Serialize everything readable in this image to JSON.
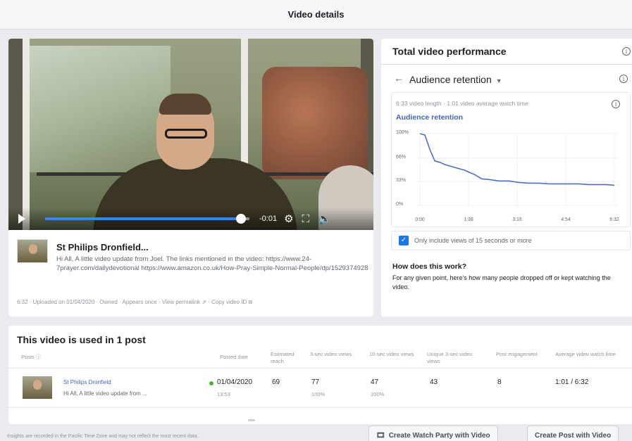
{
  "header": {
    "title": "Video details"
  },
  "player": {
    "progress": 0.96,
    "time_left": "-0:01",
    "icons": [
      "play-icon",
      "gear-icon",
      "fullscreen-icon",
      "volume-icon"
    ]
  },
  "post": {
    "page_name": "St Philips Dronfield...",
    "text": "Hi All, A little video update from Joel. The links mentioned in the video: https://www.24-7prayer.com/dailydevotional https://www.amazon.co.uk/How-Pray-Simple-Normal-People/dp/1529374928",
    "meta": "6:32 · Uploaded on 01/04/2020 · Owned · Appears once · View permalink ⇗ · Copy video ID ⧉"
  },
  "performance": {
    "title": "Total video performance",
    "back_label": "←",
    "dropdown_label": "Audience retention",
    "length_text": "6:33 video length · 1:01 video average watch time",
    "chart_title": "Audience retention",
    "checkbox_label": "Only include views of 15 seconds or more",
    "checkbox_checked": true,
    "how_title": "How does this work?",
    "how_text": "For any given point, here's how many people dropped off or kept watching the video."
  },
  "chart_data": {
    "type": "line",
    "title": "Audience retention",
    "x_ticks": [
      "0:00",
      "1:38",
      "3:16",
      "4:54",
      "6:32"
    ],
    "y_ticks": [
      "100%",
      "66%",
      "33%",
      "0%"
    ],
    "ylim": [
      0,
      100
    ],
    "xlim": [
      0,
      392
    ],
    "series": [
      {
        "name": "",
        "color": "#4a6fd1",
        "x": [
          0,
          10,
          20,
          30,
          40,
          50,
          60,
          75,
          90,
          100,
          110,
          125,
          140,
          160,
          180,
          200,
          220,
          240,
          260,
          280,
          300,
          320,
          340,
          360,
          375,
          392
        ],
        "y": [
          100,
          98,
          78,
          62,
          60,
          57,
          55,
          52,
          49,
          46,
          43,
          37,
          36,
          34,
          34,
          32,
          31,
          31,
          30,
          30,
          30,
          30,
          29,
          29,
          29,
          28
        ]
      }
    ]
  },
  "usage": {
    "title": "This video is used in 1 post",
    "columns": [
      "Posts ⓘ",
      "Posted date",
      "Estimated reach",
      "3-sec video views",
      "10-sec video views",
      "Unique 3-sec video views",
      "Post engagement",
      "Average video watch time"
    ],
    "row": {
      "page": "St Philips Dronfield",
      "text": "Hi All, A little video update from ...",
      "date": "01/04/2020",
      "time": "13:53",
      "reach": "69",
      "views3": "77",
      "views3_sub": "100%",
      "views10": "47",
      "views10_sub": "100%",
      "unique3": "43",
      "engagement": "8",
      "avg_watch": "1:01 / 6:32"
    }
  },
  "footer": {
    "note": "Insights are recorded in the Pacific Time Zone and may not reflect the most recent data.",
    "watch_party_button": "Create Watch Party with Video",
    "create_post_button": "Create Post with Video"
  }
}
